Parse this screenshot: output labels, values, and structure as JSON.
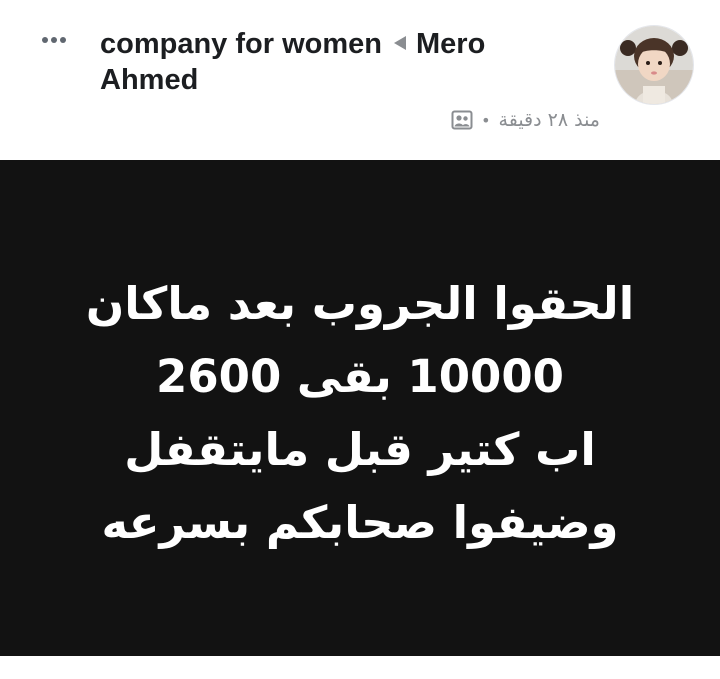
{
  "header": {
    "more_icon": "more-horizontal-icon",
    "group_name": "company for women",
    "arrow_icon": "triangle-left-icon",
    "author_name": "Mero Ahmed",
    "timestamp": "منذ ٢٨ دقيقة",
    "separator": "•",
    "privacy_icon": "group-members-icon",
    "avatar_icon": "profile-photo-avatar"
  },
  "post": {
    "background_color": "#121212",
    "text_color": "#ffffff",
    "lines": [
      "الحقوا الجروب بعد ماكان",
      "10000 بقى 2600",
      "اب كتير قبل مايتقفل",
      "وضيفوا صحابكم بسرعه"
    ]
  }
}
